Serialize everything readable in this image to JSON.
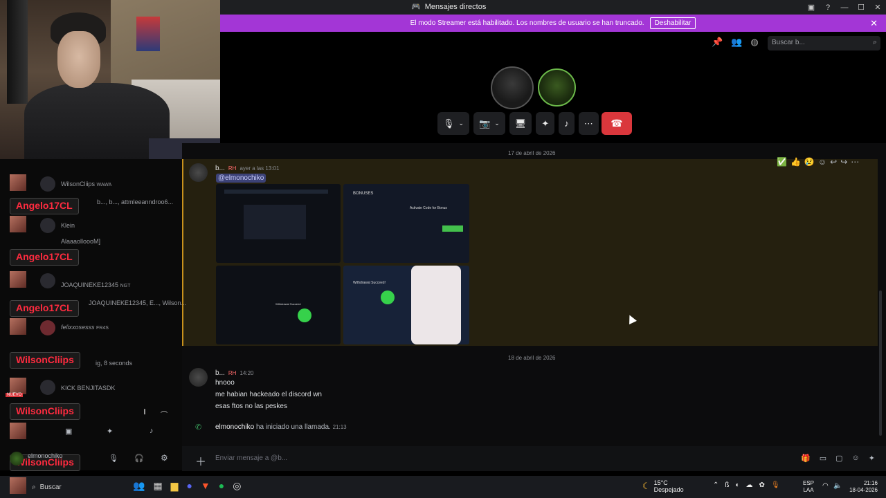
{
  "window": {
    "title": "Mensajes directos",
    "icon": "discord-icon"
  },
  "streamer_banner": {
    "text": "El modo Streamer está habilitado. Los nombres de usuario se han truncado.",
    "button": "Deshabilitar",
    "accent": "#a336d6"
  },
  "search": {
    "placeholder": "Buscar b..."
  },
  "chat": {
    "date1": "17 de abril de 2026",
    "date2": "18 de abril de 2026",
    "msg1": {
      "user": "b...",
      "tag": "RH",
      "time": "ayer a las 13:01",
      "mention": "@elmonochiko"
    },
    "msg2": {
      "user": "b...",
      "tag": "RH",
      "time": "14:20",
      "lines": [
        "hnooo",
        "me habian hackeado el discord wn",
        "esas ftos no las peskes"
      ]
    },
    "system": {
      "user": "elmonochiko",
      "text": "ha iniciado una llamada.",
      "time": "21:13"
    },
    "reactions": [
      "✅",
      "👍",
      "😢"
    ],
    "input_placeholder": "Enviar mensaje a @b...",
    "images": {
      "bonuses_title": "BONUSES",
      "activate": "Activate Code for Bonus",
      "withdrawal": "Withdrawal Succeed",
      "withdrawal2": "Withdrawal Succeed!"
    }
  },
  "overlay": {
    "rows": [
      {
        "text": "WilsonCliips",
        "badge": "WAWA"
      },
      {
        "text": "b..., b..., attmleeanndroo6..."
      },
      {
        "text": "Klein"
      },
      {
        "text": "AlaaaolloooM]"
      },
      {
        "text": "JOAQUINEKE12345",
        "badge": "NGT"
      },
      {
        "text": "JOAQUINEKE12345, E..., Wilson..."
      },
      {
        "text": "felixxosesss",
        "badge": "FR4S"
      },
      {
        "text": "ig, 8 seconds"
      },
      {
        "text": "KICK BENJITASDK"
      }
    ],
    "badges": [
      "Angelo17CL",
      "Angelo17CL",
      "Angelo17CL",
      "WilsonCliips",
      "WilsonCliips",
      "WilsonCliips"
    ],
    "user": "elmonochiko",
    "nuevo": "NUEVO"
  },
  "taskbar": {
    "search": "Buscar",
    "temp": "15°C",
    "weather": "Despejado",
    "lang1": "ESP",
    "lang2": "LAA",
    "time": "21:16",
    "date": "18-04-2026"
  }
}
